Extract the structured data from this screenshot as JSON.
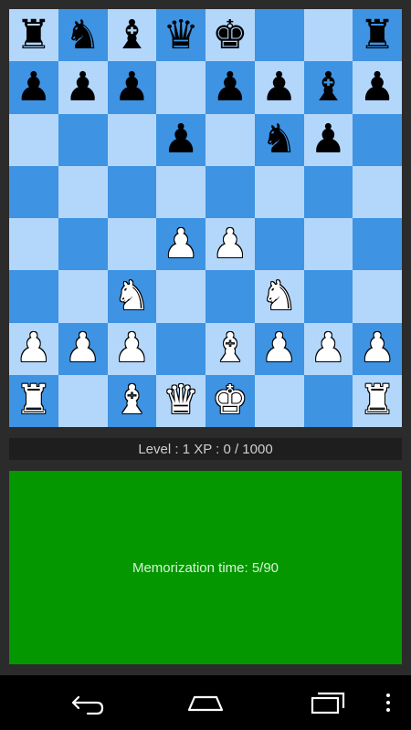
{
  "board": {
    "colors": {
      "light": "#b3d7fb",
      "dark": "#3e93e3"
    },
    "ranks": [
      [
        "br",
        "bn",
        "bb",
        "bq",
        "bk",
        "",
        "",
        "br"
      ],
      [
        "bp",
        "bp",
        "bp",
        "",
        "bp",
        "bp",
        "bb",
        "bp"
      ],
      [
        "",
        "",
        "",
        "bp",
        "",
        "bn",
        "bp",
        ""
      ],
      [
        "",
        "",
        "",
        "",
        "",
        "",
        "",
        ""
      ],
      [
        "",
        "",
        "",
        "wp",
        "wp",
        "",
        "",
        ""
      ],
      [
        "",
        "",
        "wn",
        "",
        "",
        "wn",
        "",
        ""
      ],
      [
        "wp",
        "wp",
        "wp",
        "",
        "wb",
        "wp",
        "wp",
        "wp"
      ],
      [
        "wr",
        "",
        "wb",
        "wq",
        "wk",
        "",
        "",
        "wr"
      ]
    ],
    "glyphs": {
      "k": "♚",
      "q": "♛",
      "r": "♜",
      "b": "♝",
      "n": "♞",
      "p": "♟"
    }
  },
  "status": {
    "text": "Level : 1 XP : 0 / 1000"
  },
  "memorization": {
    "text": "Memorization time: 5/90",
    "panel_color": "#049700"
  },
  "navbar": {
    "back_icon": "back-arrow-icon",
    "home_icon": "home-icon",
    "recents_icon": "recents-icon",
    "menu_icon": "overflow-menu-icon"
  }
}
